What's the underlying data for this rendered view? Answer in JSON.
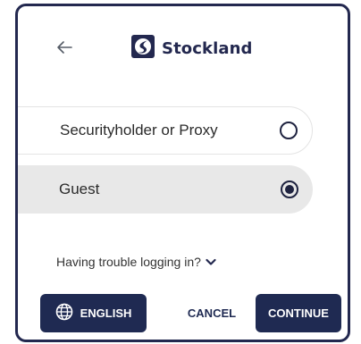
{
  "header": {
    "back_icon": "arrow-left-icon",
    "logo_icon": "stockland-logo-icon",
    "brand_name": "Stockland"
  },
  "options": [
    {
      "label": "Securityholder or Proxy",
      "selected": false
    },
    {
      "label": "Guest",
      "selected": true
    }
  ],
  "trouble": {
    "label": "Having trouble logging in?",
    "icon": "chevron-down-icon"
  },
  "footer": {
    "language_label": "ENGLISH",
    "language_icon": "globe-icon",
    "cancel_label": "CANCEL",
    "continue_label": "CONTINUE"
  },
  "colors": {
    "brand": "#23284f",
    "button": "#1f2a52",
    "selected_bg": "#e8e8e8"
  }
}
